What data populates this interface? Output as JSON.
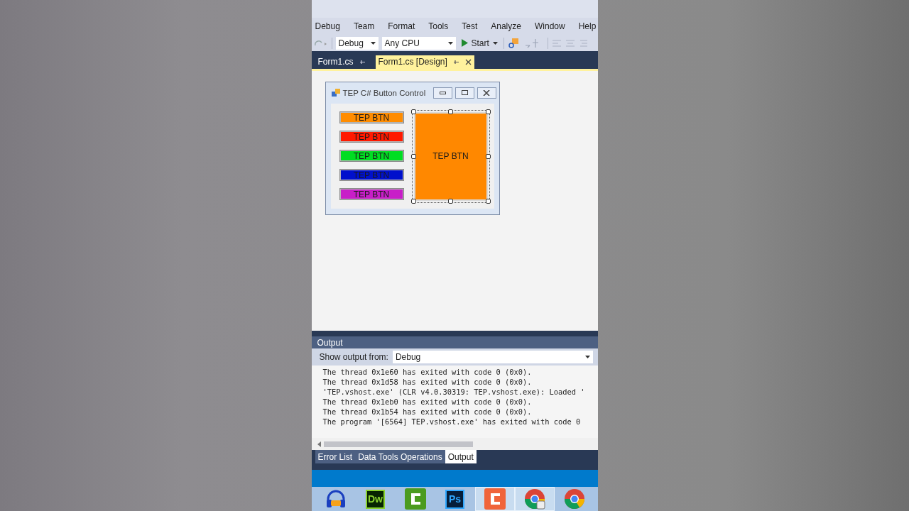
{
  "menu": [
    "Debug",
    "Team",
    "Format",
    "Tools",
    "Test",
    "Analyze",
    "Window",
    "Help"
  ],
  "toolbar": {
    "configuration": "Debug",
    "platform": "Any CPU",
    "start": "Start"
  },
  "doc_tabs": [
    {
      "label": "Form1.cs",
      "selected": false
    },
    {
      "label": "Form1.cs [Design]",
      "selected": true
    }
  ],
  "form": {
    "title": "TEP C# Button Control",
    "buttons": [
      {
        "label": "TEP BTN",
        "color": "#ff8c00"
      },
      {
        "label": "TEP BTN",
        "color": "#ff1a00"
      },
      {
        "label": "TEP BTN",
        "color": "#00dd22"
      },
      {
        "label": "TEP BTN",
        "color": "#0010cc"
      },
      {
        "label": "TEP BTN",
        "color": "#c81ec8"
      }
    ],
    "big_button": {
      "label": "TEP BTN",
      "color": "#ff8800",
      "selected": true
    }
  },
  "output": {
    "title": "Output",
    "show_from_label": "Show output from:",
    "source": "Debug",
    "lines": [
      "The thread 0x1e60 has exited with code 0 (0x0).",
      "The thread 0x1d58 has exited with code 0 (0x0).",
      "'TEP.vshost.exe' (CLR v4.0.30319: TEP.vshost.exe): Loaded '",
      "The thread 0x1eb0 has exited with code 0 (0x0).",
      "The thread 0x1b54 has exited with code 0 (0x0).",
      "The program '[6564] TEP.vshost.exe' has exited with code 0"
    ]
  },
  "bottom_tabs": [
    {
      "label": "Error List",
      "selected": false
    },
    {
      "label": "Data Tools Operations",
      "selected": false
    },
    {
      "label": "Output",
      "selected": true
    }
  ],
  "taskbar": [
    {
      "kind": "headphones",
      "active": false
    },
    {
      "kind": "dw",
      "label": "Dw",
      "active": false
    },
    {
      "kind": "cgreen",
      "active": false
    },
    {
      "kind": "ps",
      "label": "Ps",
      "active": false
    },
    {
      "kind": "corange",
      "active": true
    },
    {
      "kind": "chromeplus",
      "active": true
    },
    {
      "kind": "chrome",
      "active": false
    }
  ]
}
